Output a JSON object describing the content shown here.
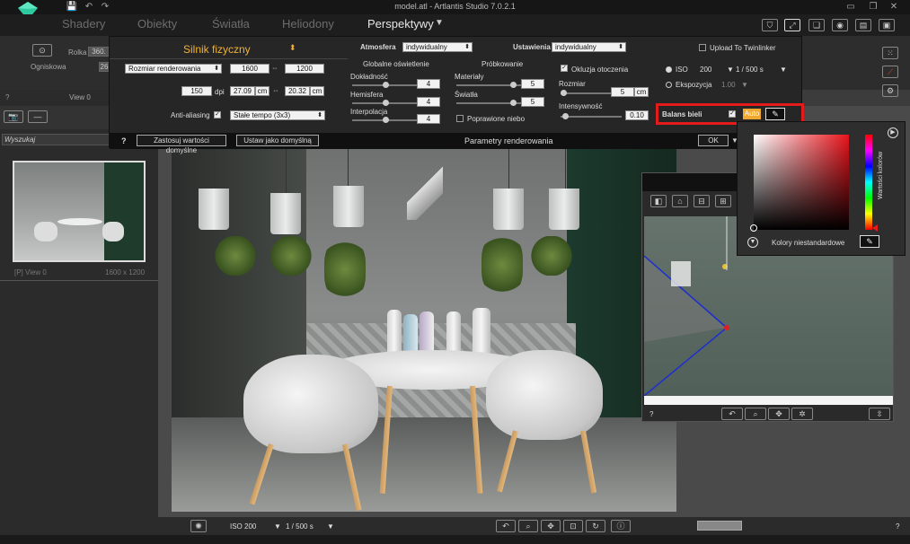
{
  "app_title": "model.atl - Artlantis Studio 7.0.2.1",
  "menu": [
    "Shadery",
    "Obiekty",
    "Światła",
    "Heliodony",
    "Perspektywy"
  ],
  "toolbar": {
    "rolka_label": "Rolka",
    "rolka_value": "360.",
    "ogniskowa_label": "Ogniskowa",
    "ogniskowa_value": "26"
  },
  "left": {
    "view_label": "View 0",
    "search_label": "Wyszukaj",
    "thumb_name": "[P] View 0",
    "thumb_size": "1600 x 1200",
    "help": "?",
    "minus": "—"
  },
  "params": {
    "engine": "Silnik fizyczny",
    "render_size_label": "Rozmiar renderowania",
    "width": "1600",
    "height": "1200",
    "dpi_value": "150",
    "dpi_unit": "dpi",
    "cm_w": "27.09",
    "cm_h": "20.32",
    "cm_unit": "cm",
    "antialias_label": "Anti-aliasing",
    "antialias_mode": "Stałe tempo (3x3)",
    "atmosfera_label": "Atmosfera",
    "atmosfera_value": "indywidualny",
    "gi_title": "Globalne oświetlenie",
    "dokladnosc": "Dokładność",
    "dokladnosc_val": "4",
    "hemisfera": "Hemisfera",
    "hemisfera_val": "4",
    "interpolacja": "Interpolacja",
    "interpolacja_val": "4",
    "probkowanie_title": "Próbkowanie",
    "materialy": "Materiały",
    "materialy_val": "5",
    "swiatla": "Światła",
    "swiatla_val": "5",
    "poprawione_niebo": "Poprawione niebo",
    "ustawienia_label": "Ustawienia",
    "ustawienia_value": "indywidualny",
    "okluzja": "Okluzja otoczenia",
    "rozmiar": "Rozmiar",
    "rozmiar_val": "5",
    "rozmiar_unit": "cm",
    "intensywnosc": "Intensywność",
    "intensywnosc_val": "0.10",
    "upload": "Upload To Twinlinker",
    "iso_label": "ISO",
    "iso_val": "200",
    "shutter": "1 / 500 s",
    "ekspozycja": "Ekspozycja",
    "ekspozycja_val": "1.00",
    "balans": "Balans bieli",
    "auto": "Auto",
    "footer_help": "?",
    "apply_default": "Zastosuj wartości domyślne",
    "set_default": "Ustaw jako domyślną",
    "footer_title": "Parametry renderowania",
    "ok": "OK"
  },
  "picker": {
    "vertical_label": "Wartości kolorów",
    "custom_label": "Kolory niestandardowe"
  },
  "bottom": {
    "iso": "ISO  200",
    "shutter": "1 / 500 s",
    "help": "?"
  },
  "colors": {
    "accent_red": "#e31b1b",
    "auto_btn": "#f0a830",
    "engine_text": "#f2b233"
  }
}
